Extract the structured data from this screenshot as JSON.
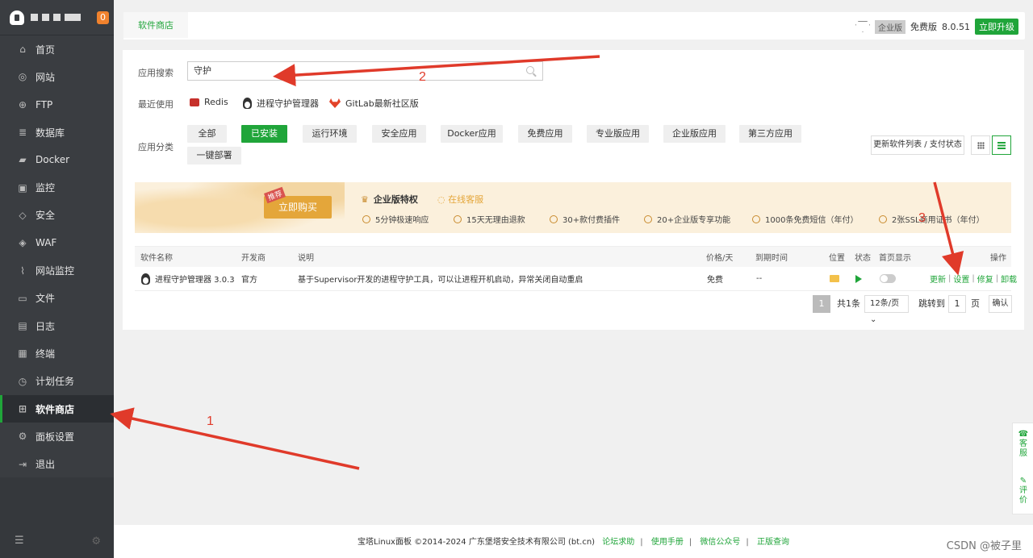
{
  "sidebar": {
    "badge": "0",
    "items": [
      {
        "label": "首页",
        "icon": "home-icon"
      },
      {
        "label": "网站",
        "icon": "globe-icon"
      },
      {
        "label": "FTP",
        "icon": "ftp-icon"
      },
      {
        "label": "数据库",
        "icon": "database-icon"
      },
      {
        "label": "Docker",
        "icon": "docker-icon"
      },
      {
        "label": "监控",
        "icon": "monitor-icon"
      },
      {
        "label": "安全",
        "icon": "shield-icon"
      },
      {
        "label": "WAF",
        "icon": "waf-shield-icon"
      },
      {
        "label": "网站监控",
        "icon": "chart-icon"
      },
      {
        "label": "文件",
        "icon": "folder-icon"
      },
      {
        "label": "日志",
        "icon": "log-icon"
      },
      {
        "label": "终端",
        "icon": "terminal-icon"
      },
      {
        "label": "计划任务",
        "icon": "clock-icon"
      },
      {
        "label": "软件商店",
        "icon": "apps-icon"
      },
      {
        "label": "面板设置",
        "icon": "gear-icon"
      },
      {
        "label": "退出",
        "icon": "logout-icon"
      }
    ],
    "active_index": 13
  },
  "topbar": {
    "tab": "软件商店",
    "edition_tag": "企业版",
    "free_label": "免费版",
    "version": "8.0.51",
    "upgrade_label": "立即升级"
  },
  "search": {
    "label": "应用搜索",
    "value": "守护"
  },
  "recent": {
    "label": "最近使用",
    "items": [
      "Redis",
      "进程守护管理器",
      "GitLab最新社区版"
    ]
  },
  "category": {
    "label": "应用分类",
    "items": [
      "全部",
      "已安装",
      "运行环境",
      "安全应用",
      "Docker应用",
      "免费应用",
      "专业版应用",
      "企业版应用",
      "第三方应用",
      "一键部署"
    ],
    "active_index": 1
  },
  "toolbar": {
    "update_label": "更新软件列表 / 支付状态"
  },
  "banner": {
    "recommend_tag": "推荐",
    "buy_label": "立即购买",
    "title": "企业版特权",
    "service": "在线客服",
    "features": [
      "5分钟极速响应",
      "15天无理由退款",
      "30+款付费插件",
      "20+企业版专享功能",
      "1000条免费短信（年付）",
      "2张SSL商用证书（年付）"
    ]
  },
  "table": {
    "headers": [
      "软件名称",
      "开发商",
      "说明",
      "价格/天",
      "到期时间",
      "位置",
      "状态",
      "首页显示",
      "操作"
    ],
    "rows": [
      {
        "name": "进程守护管理器 3.0.3",
        "developer": "官方",
        "description": "基于Supervisor开发的进程守护工具，可以让进程开机启动，异常关闭自动重启",
        "price": "免费",
        "expire": "--",
        "actions": [
          "更新",
          "设置",
          "修复",
          "卸载"
        ]
      }
    ]
  },
  "pager": {
    "page": "1",
    "total": "共1条",
    "size": "12条/页",
    "jump_label": "跳转到",
    "jump_value": "1",
    "unit": "页",
    "confirm": "确认"
  },
  "footer": {
    "copyright": "宝塔Linux面板 ©2014-2024 广东堡塔安全技术有限公司 (bt.cn)",
    "links": [
      "论坛求助",
      "使用手册",
      "微信公众号",
      "正版查询"
    ]
  },
  "float_panel": {
    "service": "客服",
    "review": "评价"
  },
  "watermark": "CSDN @被子里",
  "annotations": [
    "1",
    "2",
    "3"
  ],
  "colors": {
    "accent": "#20a53a",
    "sidebar_bg": "#3a3d41",
    "arrow": "#e03a2a"
  }
}
